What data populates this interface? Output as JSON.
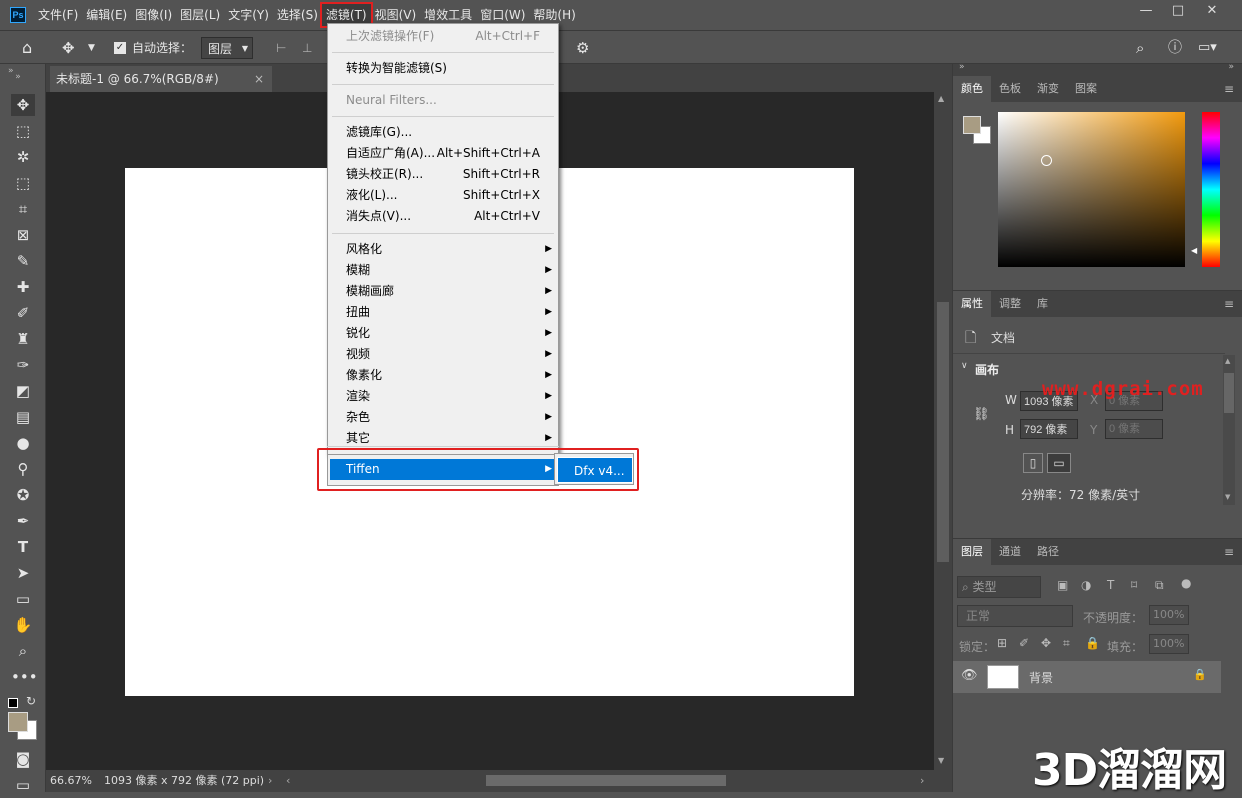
{
  "menubar": {
    "logo": "Ps",
    "items": [
      "文件(F)",
      "编辑(E)",
      "图像(I)",
      "图层(L)",
      "文字(Y)",
      "选择(S)",
      "滤镜(T)",
      "视图(V)",
      "增效工具",
      "窗口(W)",
      "帮助(H)"
    ]
  },
  "options": {
    "auto_select_label": "自动选择：",
    "auto_select_value": "图层"
  },
  "document": {
    "tab_title": "未标题-1 @ 66.7%(RGB/8#)",
    "close": "×"
  },
  "status": {
    "zoom": "66.67%",
    "info": "1093 像素 x 792 像素 (72 ppi)"
  },
  "filter_menu": {
    "last_filter": "上次滤镜操作(F)",
    "last_filter_sc": "Alt+Ctrl+F",
    "smart": "转换为智能滤镜(S)",
    "neural": "Neural Filters...",
    "gallery": "滤镜库(G)...",
    "adaptive": "自适应广角(A)...",
    "adaptive_sc": "Alt+Shift+Ctrl+A",
    "lens": "镜头校正(R)...",
    "lens_sc": "Shift+Ctrl+R",
    "liquify": "液化(L)...",
    "liquify_sc": "Shift+Ctrl+X",
    "vanish": "消失点(V)...",
    "vanish_sc": "Alt+Ctrl+V",
    "sub": [
      "风格化",
      "模糊",
      "模糊画廊",
      "扭曲",
      "锐化",
      "视频",
      "像素化",
      "渲染",
      "杂色",
      "其它"
    ],
    "tiffen": "Tiffen",
    "tiffen_sub": "Dfx v4..."
  },
  "color_panel": {
    "tabs": [
      "颜色",
      "色板",
      "渐变",
      "图案"
    ],
    "hue_color": "#f29a0e",
    "foreground": "#a89c83"
  },
  "properties_panel": {
    "tabs": [
      "属性",
      "调整",
      "库"
    ],
    "doc_label": "文档",
    "canvas_label": "画布",
    "w_label": "W",
    "w_value": "1093 像素",
    "h_label": "H",
    "h_value": "792 像素",
    "x_label": "X",
    "x_placeholder": "0 像素",
    "y_label": "Y",
    "y_placeholder": "0 像素",
    "resolution": "分辨率：72 像素/英寸"
  },
  "layers_panel": {
    "tabs": [
      "图层",
      "通道",
      "路径"
    ],
    "kind": "类型",
    "blend": "正常",
    "opacity_label": "不透明度：",
    "opacity": "100%",
    "lock_label": "锁定：",
    "fill_label": "填充：",
    "fill": "100%",
    "layer_name": "背景"
  },
  "watermarks": {
    "url": "www.dgrai.com",
    "brand": "3D溜溜网"
  }
}
